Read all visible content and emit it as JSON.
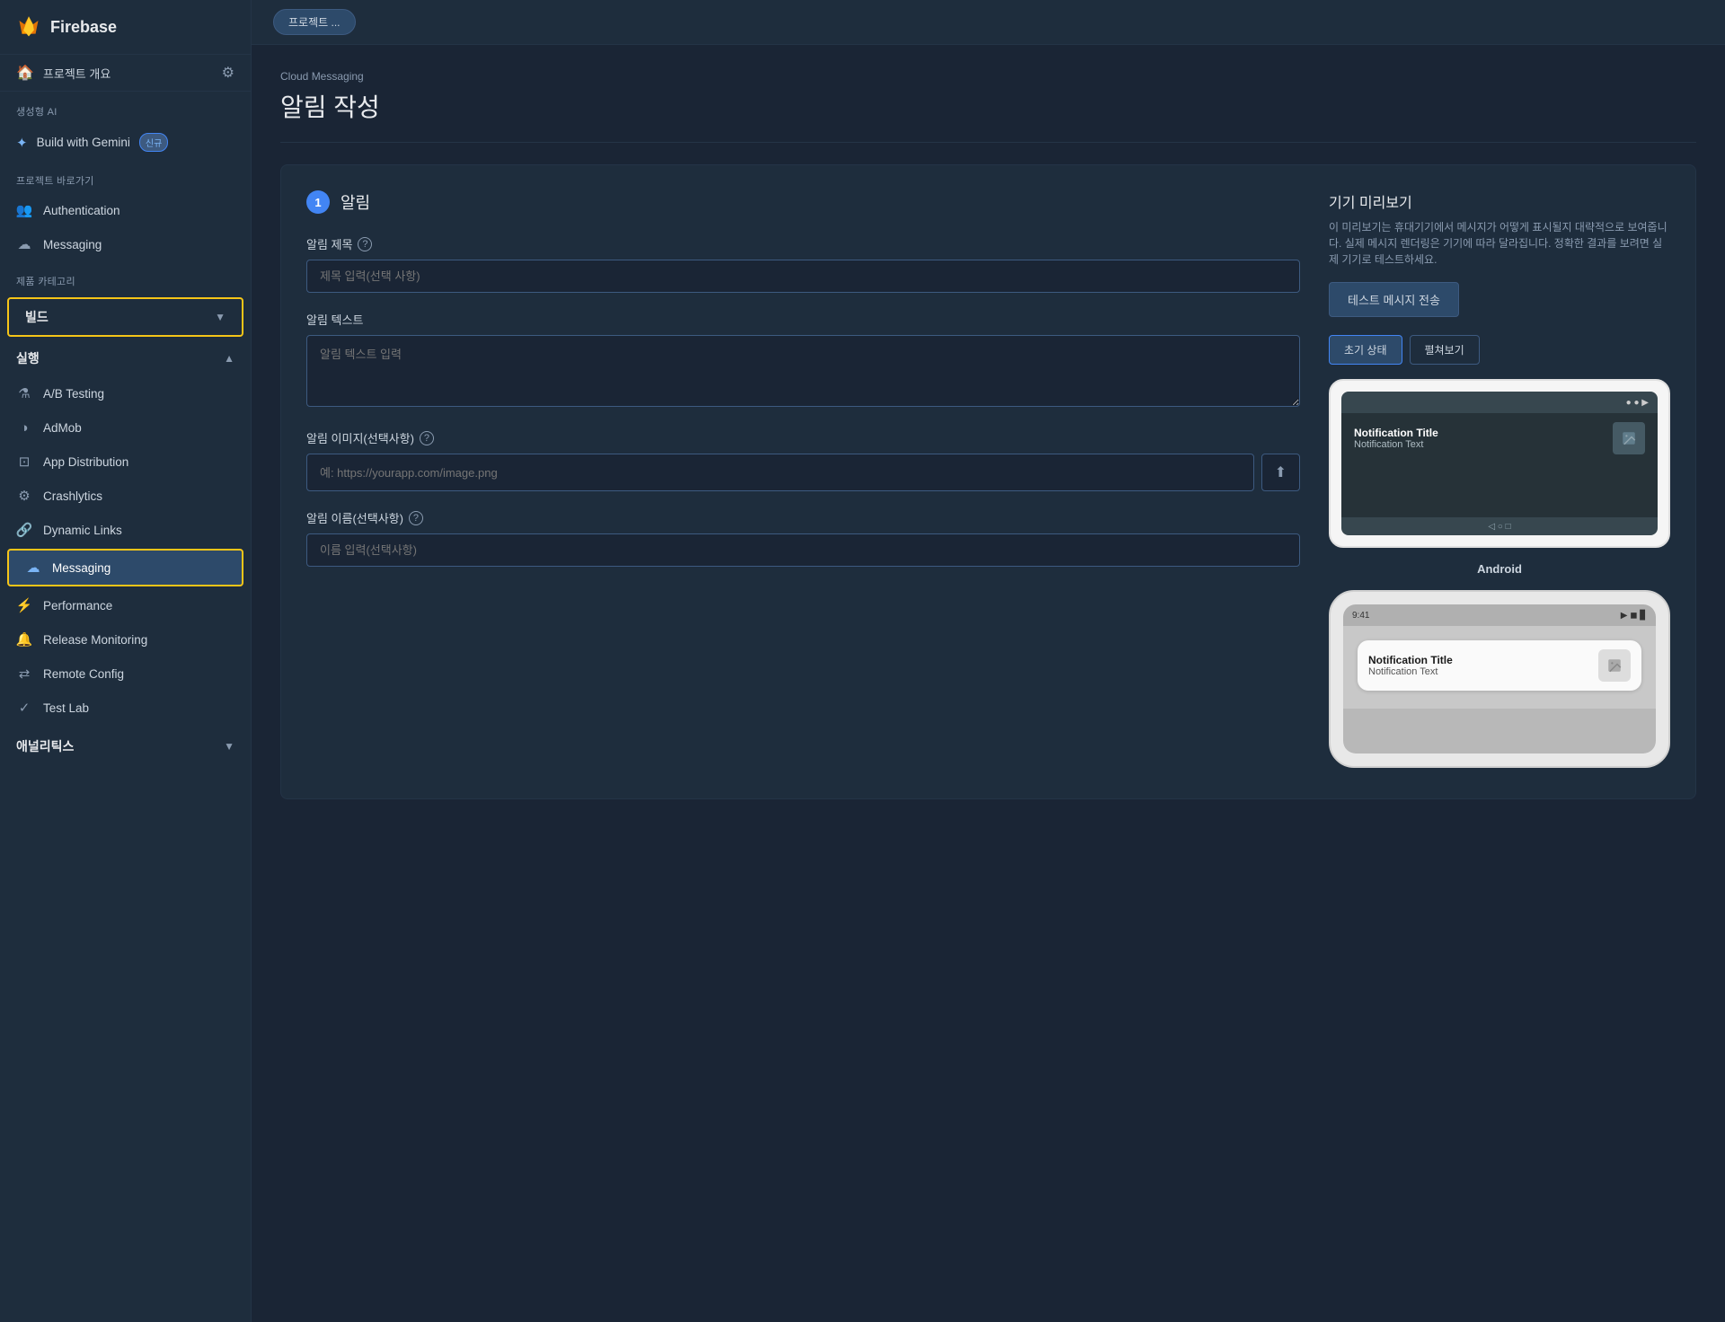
{
  "app": {
    "title": "Firebase"
  },
  "project": {
    "name": "프로젝트 개요",
    "tab_label": "프로젝트 ..."
  },
  "sidebar": {
    "generative_ai_label": "생성형 AI",
    "gemini_label": "Build with Gemini",
    "gemini_badge": "신규",
    "shortcuts_label": "프로젝트 바로가기",
    "authentication_label": "Authentication",
    "messaging_label": "Messaging",
    "products_label": "제품 카테고리",
    "build_label": "빌드",
    "run_label": "실행",
    "ab_testing_label": "A/B Testing",
    "admob_label": "AdMob",
    "app_distribution_label": "App Distribution",
    "crashlytics_label": "Crashlytics",
    "dynamic_links_label": "Dynamic Links",
    "messaging_item_label": "Messaging",
    "performance_label": "Performance",
    "release_monitoring_label": "Release Monitoring",
    "remote_config_label": "Remote Config",
    "test_lab_label": "Test Lab",
    "analytics_label": "애널리틱스"
  },
  "page": {
    "breadcrumb": "Cloud Messaging",
    "title": "알림 작성"
  },
  "form": {
    "section_number": "1",
    "section_title": "알림",
    "notification_title_label": "알림 제목",
    "notification_title_placeholder": "제목 입력(선택 사항)",
    "notification_text_label": "알림 텍스트",
    "notification_text_placeholder": "알림 텍스트 입력",
    "notification_image_label": "알림 이미지(선택사항)",
    "notification_image_placeholder": "예: https://yourapp.com/image.png",
    "notification_name_label": "알림 이름(선택사항)",
    "notification_name_placeholder": "이름 입력(선택사항)"
  },
  "preview": {
    "title": "기기 미리보기",
    "description": "이 미리보기는 휴대기기에서 메시지가 어떻게 표시될지 대략적으로 보여줍니다. 실제 메시지 렌더링은 기기에 따라 달라집니다. 정확한 결과를 보려면 실제 기기로 테스트하세요.",
    "test_button": "테스트 메시지 전송",
    "initial_state_btn": "초기 상태",
    "expand_btn": "펼쳐보기",
    "notification_title": "Notification Title",
    "notification_text": "Notification Text",
    "android_label": "Android",
    "ios_notification_title": "Notification Title",
    "ios_notification_text": "Notification Text"
  }
}
